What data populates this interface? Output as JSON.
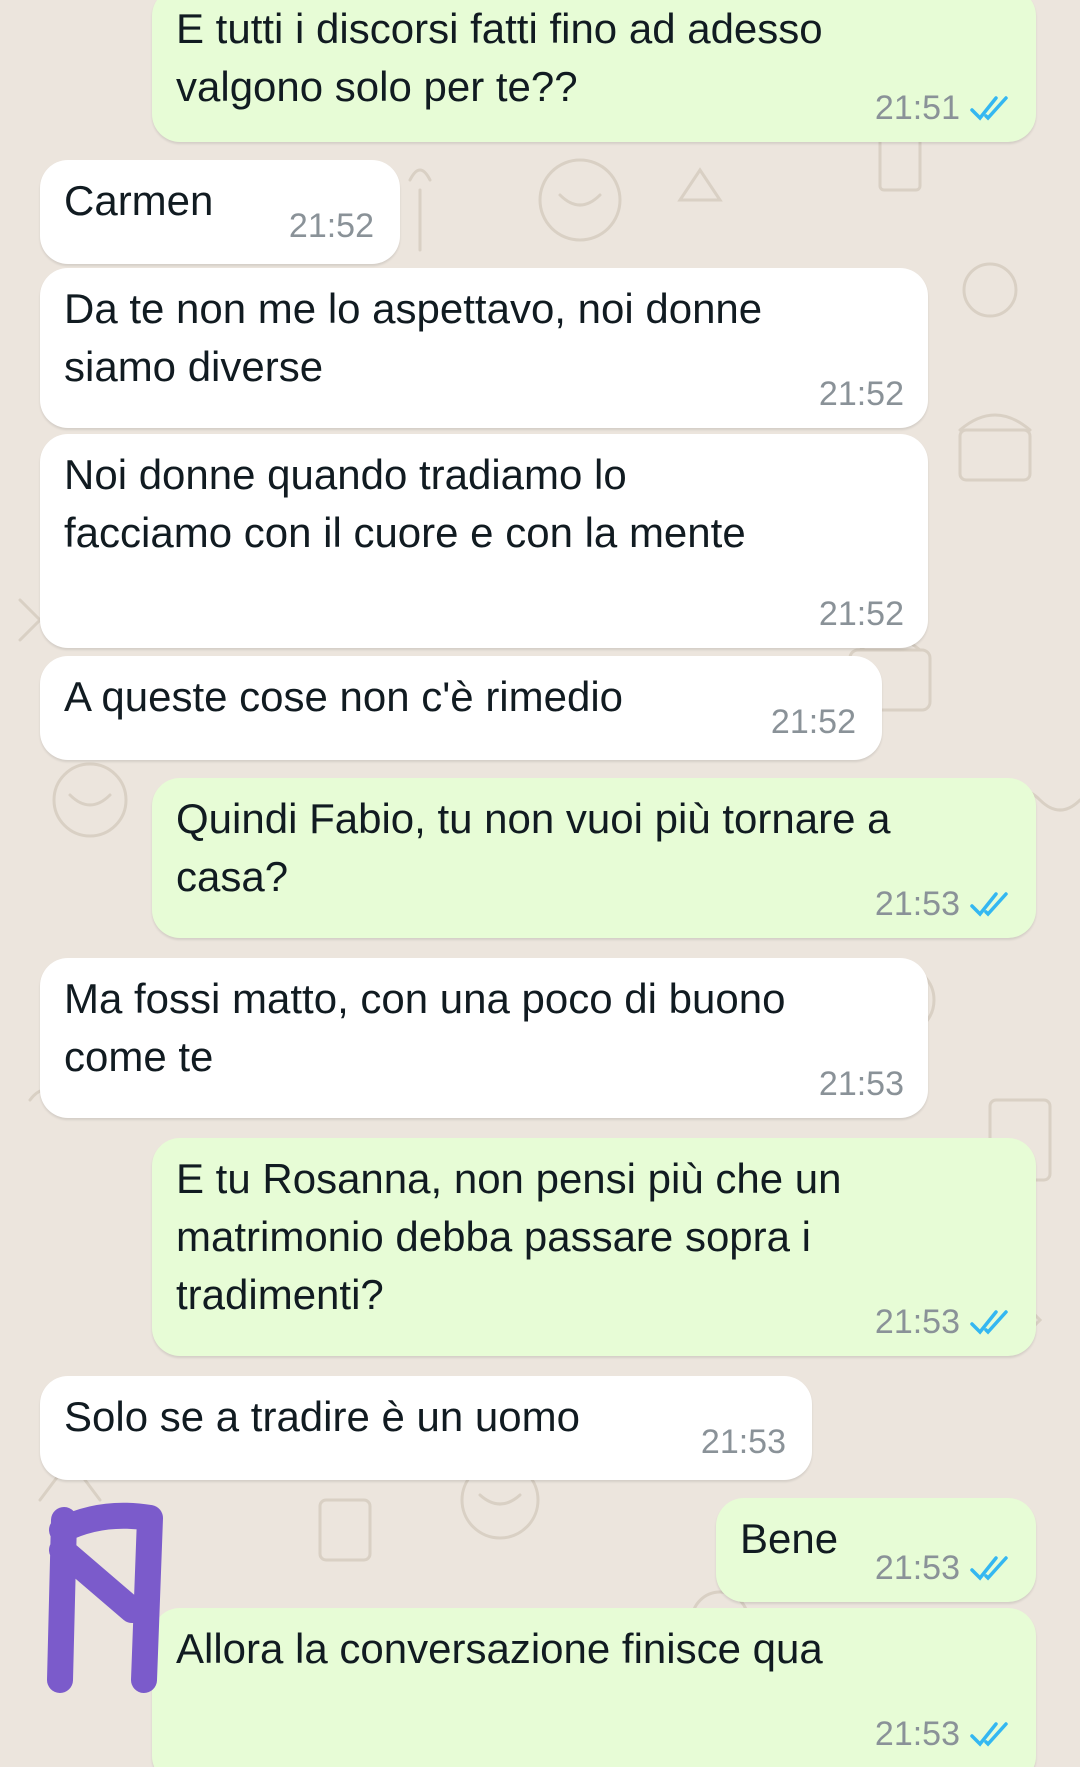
{
  "colors": {
    "background": "#ECE5DD",
    "incoming_bubble": "#FFFFFF",
    "outgoing_bubble": "#E7FCD6",
    "read_ticks": "#34B7F1",
    "timestamp": "#8A9298",
    "scribble": "#7B5BCB"
  },
  "messages": [
    {
      "direction": "out",
      "text": "E tutti i discorsi fatti fino ad adesso\nvalgono solo per te??",
      "time": "21:51",
      "status_icon": "double-check-read-icon"
    },
    {
      "direction": "in",
      "text": "Carmen",
      "time": "21:52"
    },
    {
      "direction": "in",
      "text": "Da te non me lo aspettavo, noi donne\nsiamo diverse",
      "time": "21:52"
    },
    {
      "direction": "in",
      "text": "Noi donne quando tradiamo lo\nfacciamo con il cuore e con la mente",
      "time": "21:52"
    },
    {
      "direction": "in",
      "text": "A queste cose non c'è rimedio",
      "time": "21:52"
    },
    {
      "direction": "out",
      "text": "Quindi Fabio, tu non vuoi più tornare a\ncasa?",
      "time": "21:53",
      "status_icon": "double-check-read-icon"
    },
    {
      "direction": "in",
      "text": "Ma fossi matto, con una poco di buono\ncome te",
      "time": "21:53"
    },
    {
      "direction": "out",
      "text": "E tu Rosanna, non pensi più che un\nmatrimonio debba passare sopra i\ntradimenti?",
      "time": "21:53",
      "status_icon": "double-check-read-icon"
    },
    {
      "direction": "in",
      "text": "Solo se a tradire è un uomo",
      "time": "21:53"
    },
    {
      "direction": "out",
      "text": "Bene",
      "time": "21:53",
      "status_icon": "double-check-read-icon"
    },
    {
      "direction": "out",
      "text": "Allora la conversazione finisce qua",
      "time": "21:53",
      "status_icon": "double-check-read-icon"
    }
  ]
}
